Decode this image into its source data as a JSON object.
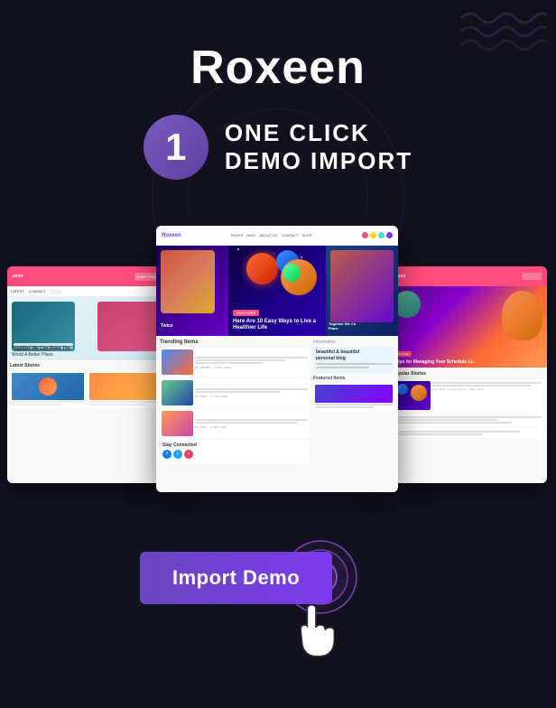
{
  "header": {
    "title": "Roxeen"
  },
  "badge": {
    "number": "1"
  },
  "oneclick": {
    "line1": "ONE CLICK",
    "line2": "DEMO IMPORT"
  },
  "button": {
    "label": "Import Demo"
  },
  "colors": {
    "background": "#12121f",
    "badge_gradient_start": "#7c5cbf",
    "badge_gradient_end": "#5b3fa0",
    "button_gradient_start": "#6b46c1",
    "button_gradient_end": "#7c3aed",
    "title_color": "#ffffff"
  }
}
